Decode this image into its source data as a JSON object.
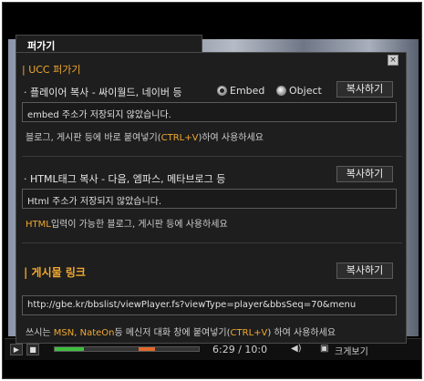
{
  "player": {
    "time_current": "6:29",
    "time_separator": "/",
    "time_total": "10:0",
    "fullscreen_label": "크게보기",
    "progress_fraction": 0.2
  },
  "popup": {
    "tab_label": "퍼가기",
    "close_glyph": "×",
    "ucc_section_title": "| UCC 퍼가기",
    "embed": {
      "label": "· 플레이어 복사 - 싸이월드, 네이버 등",
      "radio_embed": "Embed",
      "radio_object": "Object",
      "copy_button": "복사하기",
      "field_value": "embed 주소가 저장되지 않았습니다.",
      "hint_prefix": "블로그, 게시판 등에 바로 붙여넣기(",
      "hint_key": "CTRL+V",
      "hint_suffix": ")하여 사용하세요"
    },
    "html": {
      "label": "· HTML태그 복사 - 다음, 엠파스, 메타브로그 등",
      "copy_button": "복사하기",
      "field_value": "Html 주소가 저장되지 않았습니다.",
      "hint_highlight": "HTML",
      "hint_suffix": "입력이 가능한 블로그, 게시판 등에 사용하세요"
    },
    "link": {
      "section_title": "| 게시물 링크",
      "copy_button": "복사하기",
      "field_value": "http://gbe.kr/bbslist/viewPlayer.fs?viewType=player&bbsSeq=70&menu",
      "hint_prefix": "쓰시는 ",
      "hint_messengers": "MSN, NateOn",
      "hint_middle": "등 메신저 대화 창에 붙여넣기(",
      "hint_key": "CTRL+V",
      "hint_suffix": ") 하여 사용하세요"
    }
  }
}
